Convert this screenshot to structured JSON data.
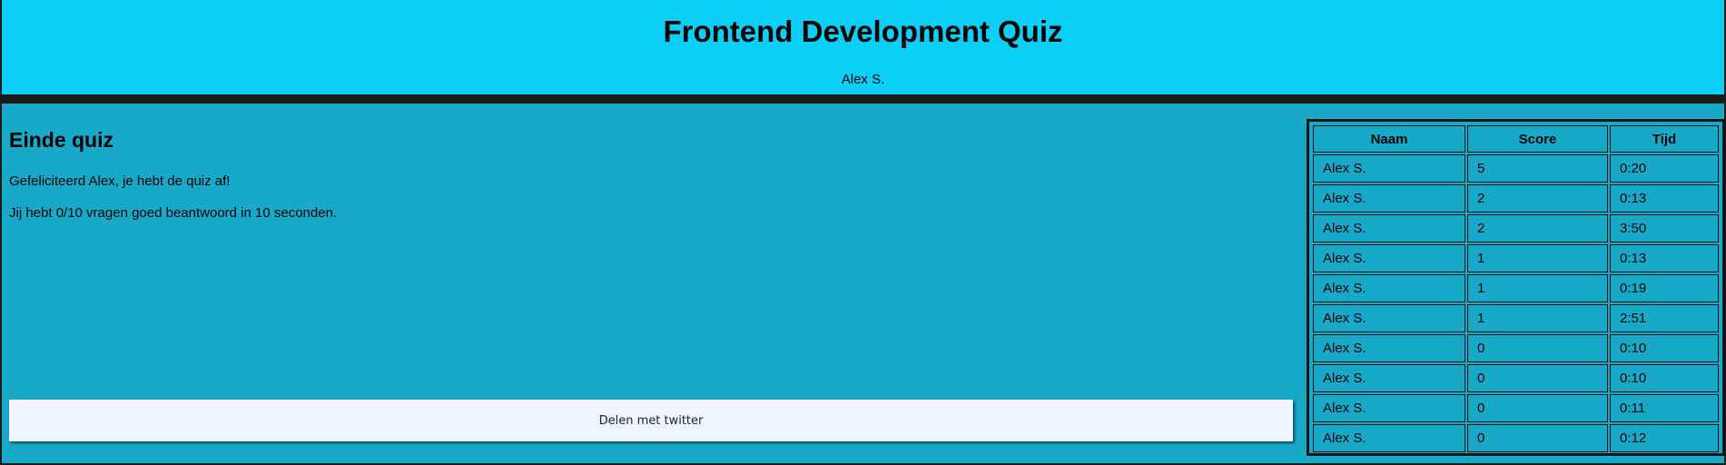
{
  "header": {
    "title": "Frontend Development Quiz",
    "user": "Alex S."
  },
  "main": {
    "heading": "Einde quiz",
    "congrats": "Gefeliciteerd Alex, je hebt de quiz af!",
    "result": "Jij hebt 0/10 vragen goed beantwoord in 10 seconden.",
    "share_label": "Delen met twitter"
  },
  "leaderboard": {
    "columns": [
      "Naam",
      "Score",
      "Tijd"
    ],
    "rows": [
      [
        "Alex S.",
        "5",
        "0:20"
      ],
      [
        "Alex S.",
        "2",
        "0:13"
      ],
      [
        "Alex S.",
        "2",
        "3:50"
      ],
      [
        "Alex S.",
        "1",
        "0:13"
      ],
      [
        "Alex S.",
        "1",
        "0:19"
      ],
      [
        "Alex S.",
        "1",
        "2:51"
      ],
      [
        "Alex S.",
        "0",
        "0:10"
      ],
      [
        "Alex S.",
        "0",
        "0:10"
      ],
      [
        "Alex S.",
        "0",
        "0:11"
      ],
      [
        "Alex S.",
        "0",
        "0:12"
      ]
    ]
  },
  "colors": {
    "header_bg": "#0ccff7",
    "body_bg": "#18a9c9",
    "button_bg": "#eef5ff"
  }
}
